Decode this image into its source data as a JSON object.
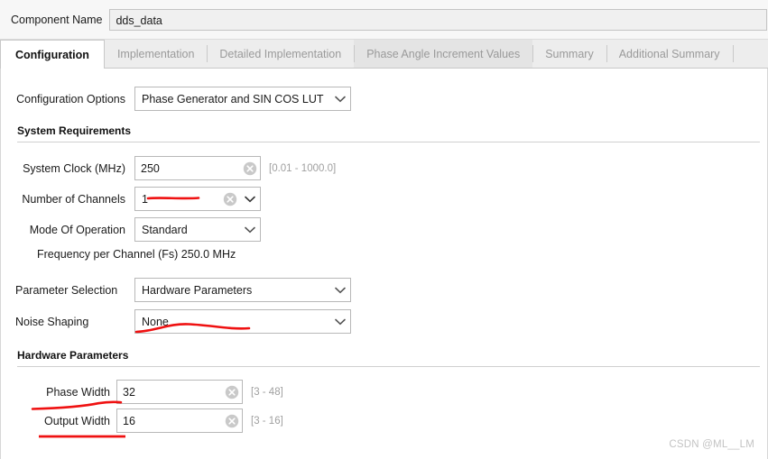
{
  "header": {
    "component_name_label": "Component Name",
    "component_name_value": "dds_data"
  },
  "tabs": [
    {
      "label": "Configuration",
      "active": true
    },
    {
      "label": "Implementation",
      "active": false
    },
    {
      "label": "Detailed Implementation",
      "active": false
    },
    {
      "label": "Phase Angle Increment Values",
      "active": false
    },
    {
      "label": "Summary",
      "active": false
    },
    {
      "label": "Additional Summary",
      "active": false
    }
  ],
  "config": {
    "options_label": "Configuration Options",
    "options_value": "Phase Generator and SIN COS LUT"
  },
  "system_requirements": {
    "title": "System Requirements",
    "system_clock_label": "System Clock (MHz)",
    "system_clock_value": "250",
    "system_clock_hint": "[0.01 - 1000.0]",
    "channels_label": "Number of Channels",
    "channels_value": "1",
    "mode_label": "Mode Of Operation",
    "mode_value": "Standard",
    "frequency_text": "Frequency per Channel (Fs) 250.0 MHz"
  },
  "parameters": {
    "selection_label": "Parameter Selection",
    "selection_value": "Hardware Parameters",
    "noise_label": "Noise Shaping",
    "noise_value": "None"
  },
  "hardware_parameters": {
    "title": "Hardware Parameters",
    "phase_width_label": "Phase Width",
    "phase_width_value": "32",
    "phase_width_hint": "[3 - 48]",
    "output_width_label": "Output Width",
    "output_width_value": "16",
    "output_width_hint": "[3 - 16]"
  },
  "annotation_color": "#ef1111",
  "watermark": "CSDN @ML__LM"
}
